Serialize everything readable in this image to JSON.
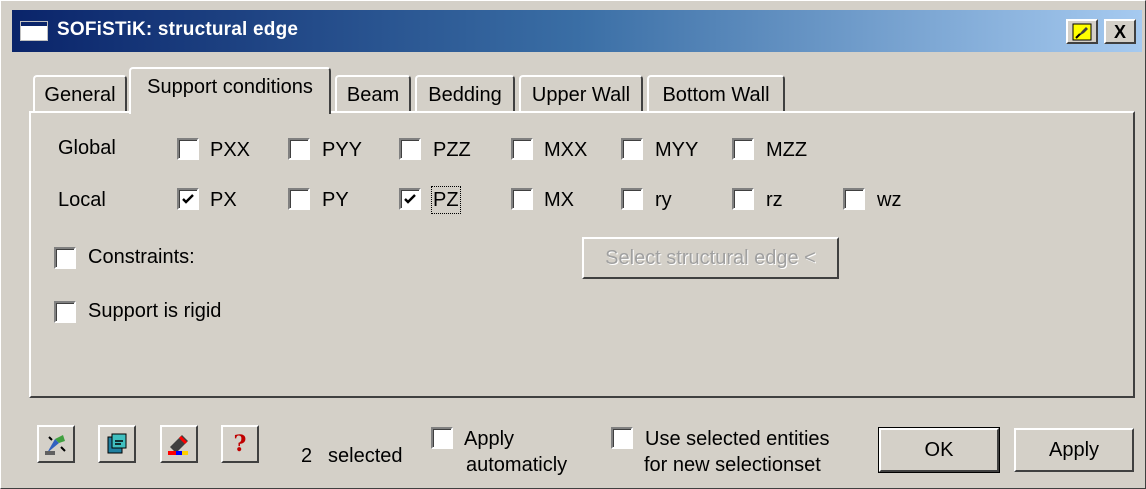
{
  "window": {
    "title": "SOFiSTiK: structural edge",
    "pin_icon": "pin-icon",
    "close_label": "X"
  },
  "tabs": [
    {
      "label": "General",
      "active": false
    },
    {
      "label": "Support conditions",
      "active": true
    },
    {
      "label": "Beam",
      "active": false
    },
    {
      "label": "Bedding",
      "active": false
    },
    {
      "label": "Upper Wall",
      "active": false
    },
    {
      "label": "Bottom Wall",
      "active": false
    }
  ],
  "global": {
    "label": "Global",
    "items": [
      {
        "label": "PXX",
        "checked": false
      },
      {
        "label": "PYY",
        "checked": false
      },
      {
        "label": "PZZ",
        "checked": false
      },
      {
        "label": "MXX",
        "checked": false
      },
      {
        "label": "MYY",
        "checked": false
      },
      {
        "label": "MZZ",
        "checked": false
      }
    ]
  },
  "local": {
    "label": "Local",
    "items": [
      {
        "label": "PX",
        "checked": true
      },
      {
        "label": "PY",
        "checked": false
      },
      {
        "label": "PZ",
        "checked": true
      },
      {
        "label": "MX",
        "checked": false
      },
      {
        "label": "ry",
        "checked": false
      },
      {
        "label": "rz",
        "checked": false
      },
      {
        "label": "wz",
        "checked": false
      }
    ]
  },
  "constraints": {
    "label": "Constraints:",
    "checked": false
  },
  "select_edge_button": "Select structural edge <",
  "support_rigid": {
    "label": "Support is rigid",
    "checked": false
  },
  "footer": {
    "icon_buttons": [
      "wizard-icon",
      "settings-icon",
      "paint-icon",
      "help-icon"
    ],
    "help_glyph": "?",
    "selected_count": "2",
    "selected_text": "selected",
    "apply_auto_line1": "Apply",
    "apply_auto_line2": "automaticly",
    "use_selected_line1": "Use selected entities",
    "use_selected_line2": "for new selectionset",
    "ok_label": "OK",
    "apply_label": "Apply"
  }
}
